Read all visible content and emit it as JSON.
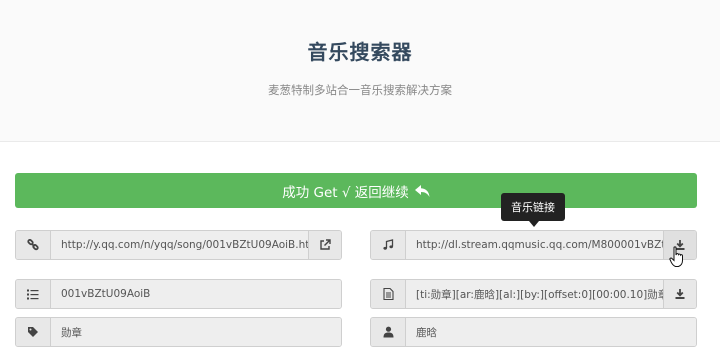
{
  "header": {
    "title": "音乐搜索器",
    "subtitle": "麦葱特制多站合一音乐搜索解决方案"
  },
  "success_button": {
    "label": "成功 Get √ 返回继续"
  },
  "tooltip": {
    "text": "音乐链接"
  },
  "fields": {
    "song_link": "http://y.qq.com/n/yqq/song/001vBZtU09AoiB.ht...",
    "music_link": "http://dl.stream.qqmusic.qq.com/M800001vBZt...",
    "song_id": "001vBZtU09AoiB",
    "lyrics": "[ti:勋章][ar:鹿晗][al:][by:][offset:0][00:00.10]勋章 (...",
    "song_title": "勋章",
    "artist": "鹿晗"
  },
  "colors": {
    "success": "#5cb85c",
    "title": "#34495e"
  }
}
